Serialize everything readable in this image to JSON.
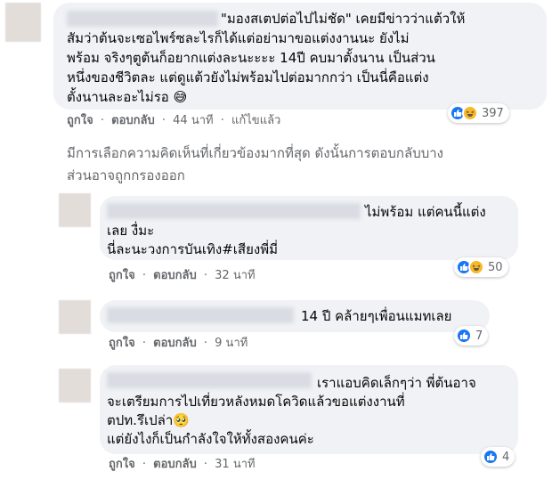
{
  "comments": [
    {
      "lines": [
        "\"มองสเตปต่อไปไม่ชัด\" เคยมีข่าวว่าแต้วให้",
        "สัมว่าต้นจะเซอไพร์ซละไรก็ได้แต่อย่ามาขอแต่งงานนะ ยังไม่",
        "พร้อม จริงๆตูต้นก็อยากแต่งละนะะะะ 14ปี คบมาตั้งนาน เป็นส่วน",
        "หนึ่งของชีวิตละ แต่ดูแต้วยังไม่พร้อมไปต่อมากกว่า เป็นนี่คือแต่ง",
        "ตั้งนานละอะไม่รอ 😅"
      ],
      "reaction_count": "397",
      "reactions": [
        "like-icon",
        "haha-icon"
      ],
      "meta": {
        "like": "ถูกใจ",
        "reply": "ตอบกลับ",
        "time": "44 นาที",
        "edited": "แก้ไขแล้ว"
      }
    },
    {
      "lines": [
        "ไม่พร้อม แต่คนนี้แต่ง",
        "เลย งื่มะ",
        "นี่ละนะวงการบันเทิง#เสียงพี่มี่"
      ],
      "reaction_count": "50",
      "reactions": [
        "like-icon",
        "haha-icon"
      ],
      "meta": {
        "like": "ถูกใจ",
        "reply": "ตอบกลับ",
        "time": "32 นาที"
      }
    },
    {
      "lines": [
        "14 ปี คล้ายๆเพื่อนแมทเลย"
      ],
      "reaction_count": "7",
      "reactions": [
        "like-icon"
      ],
      "meta": {
        "like": "ถูกใจ",
        "reply": "ตอบกลับ",
        "time": "9 นาที"
      }
    },
    {
      "lines": [
        "เราแอบคิดเล็กๆว่า พี่ต้นอาจ",
        "จะเตรียมการไปเที่ยวหลังหมดโควิดแล้วขอแต่งงานที่",
        "ตปท.รึเปล่า🥺",
        "แต่ยังไงก็เป็นกำลังใจให้ทั้งสองคนค่ะ"
      ],
      "reaction_count": "4",
      "reactions": [
        "like-icon"
      ],
      "meta": {
        "like": "ถูกใจ",
        "reply": "ตอบกลับ",
        "time": "31 นาที"
      }
    }
  ],
  "filter_notice": [
    "มีการเลือกความคิดเห็นที่เกี่ยวข้องมากที่สุด ดังนั้นการตอบกลับบาง",
    "ส่วนอาจถูกกรองออก"
  ],
  "separator": "·",
  "colors": {
    "like": "#1877f2",
    "haha": "#f7b928",
    "bubble": "#f0f2f5",
    "meta": "#65676b"
  }
}
